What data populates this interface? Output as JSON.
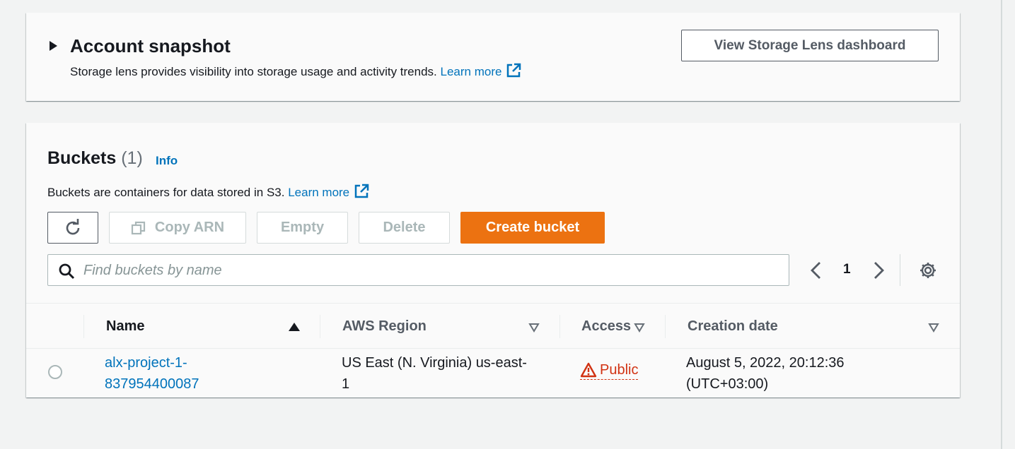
{
  "snapshot": {
    "title": "Account snapshot",
    "description": "Storage lens provides visibility into storage usage and activity trends.",
    "learn_more": "Learn more",
    "view_button": "View Storage Lens dashboard"
  },
  "buckets": {
    "title": "Buckets",
    "count": "(1)",
    "info": "Info",
    "description": "Buckets are containers for data stored in S3.",
    "learn_more": "Learn more",
    "actions": {
      "copy_arn": "Copy ARN",
      "empty": "Empty",
      "delete": "Delete",
      "create": "Create bucket"
    },
    "search": {
      "placeholder": "Find buckets by name",
      "value": ""
    },
    "pagination": {
      "current_page": "1"
    },
    "columns": [
      "Name",
      "AWS Region",
      "Access",
      "Creation date"
    ],
    "rows": [
      {
        "name_line1": "alx-project-1-",
        "name_line2": "837954400087",
        "region_line1": "US East (N. Virginia) us-east-",
        "region_line2": "1",
        "access": "Public",
        "date_line1": "August 5, 2022, 20:12:36",
        "date_line2": "(UTC+03:00)"
      }
    ]
  },
  "colors": {
    "accent": "#ec7211",
    "link": "#0073bb",
    "warning": "#d13212",
    "background": "#f2f3f3"
  }
}
